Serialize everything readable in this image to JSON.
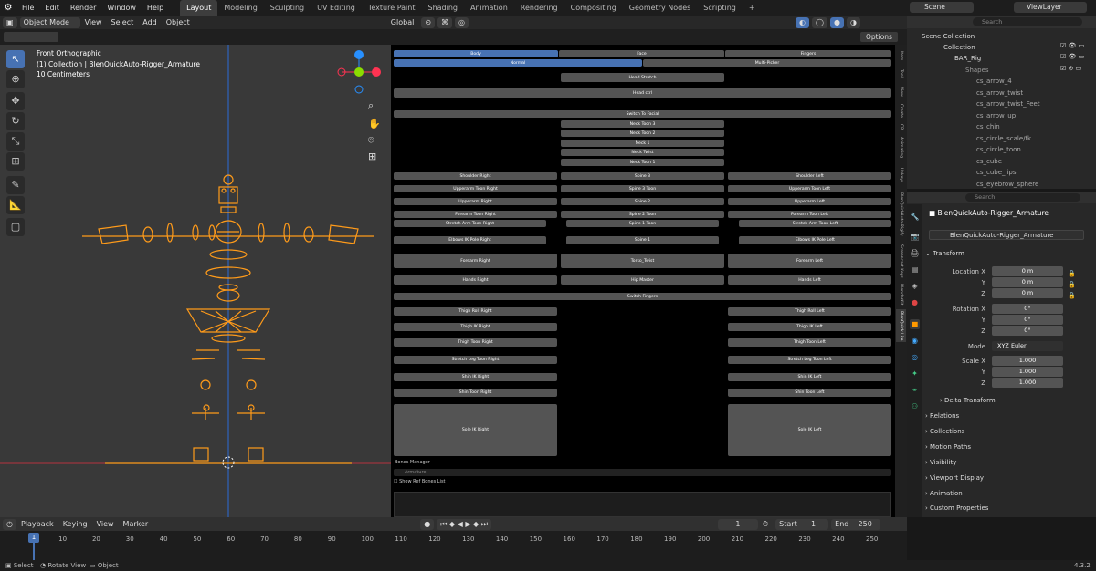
{
  "menu": [
    "File",
    "Edit",
    "Render",
    "Window",
    "Help"
  ],
  "workspaces": [
    "Layout",
    "Modeling",
    "Sculpting",
    "UV Editing",
    "Texture Paint",
    "Shading",
    "Animation",
    "Rendering",
    "Compositing",
    "Geometry Nodes",
    "Scripting"
  ],
  "active_workspace": "Layout",
  "scene": "Scene",
  "view_layer": "ViewLayer",
  "header": {
    "mode": "Object Mode",
    "view": "View",
    "select": "Select",
    "add": "Add",
    "object": "Object",
    "transform": "Global",
    "search_placeholder": "Search",
    "options": "Options"
  },
  "viewport": {
    "title": "Front Orthographic",
    "collection": "(1) Collection | BlenQuickAuto-Rigger_Armature",
    "scale": "10 Centimeters"
  },
  "picker": {
    "tabs_top": [
      "Body",
      "Face",
      "Fingers"
    ],
    "tabs_mode": [
      "Normal",
      "Multi-Picker"
    ],
    "head_stretch": "Head Stretch",
    "head_ctrl": "Head ctrl",
    "switch_facial": "Switch To Facial",
    "neck": [
      "Neck Toon 3",
      "Neck Toon 2",
      "Neck 1",
      "Neck Twist",
      "Neck Toon 1"
    ],
    "shoulder_r": "Shoulder Right",
    "spine3": "Spine 3",
    "shoulder_l": "Shoulder Left",
    "upperarm_toon_r": "Upperarm Toon Right",
    "spine3_toon": "Spine 3 Toon",
    "upperarm_toon_l": "Upperarm Toon Left",
    "upperarm_r": "Upperarm Right",
    "spine2": "Spine 2",
    "upperarm_l": "Upperarm Left",
    "forearm_toon_r": "Forearm Toon Right",
    "spine2_toon": "Spine 2 Toon",
    "forearm_toon_l": "Forearm Toon Left",
    "stretch_arm_r": "Stretch Arm Toon Right",
    "spine1_toon": "Spine 1 Toon",
    "stretch_arm_l": "Stretch Arm Toon Left",
    "elbow_ik_r": "Elbows IK Pole Right",
    "spine1": "Spine 1",
    "elbow_ik_l": "Elbows IK Pole Left",
    "forearm_r": "Forearm Right",
    "torso_twist": "Torso_Twist",
    "forearm_l": "Forearm Left",
    "hands_r": "Hands Right",
    "hip_master": "Hip Master",
    "hands_l": "Hands Left",
    "switch_fingers": "Switch Fingers",
    "thigh_roll_r": "Thigh Roll Right",
    "thigh_roll_l": "Thigh Roll Left",
    "thigh_ik_r": "Thigh IK Right",
    "thigh_ik_l": "Thigh IK Left",
    "thigh_toon_r": "Thigh Toon Right",
    "thigh_toon_l": "Thigh Toon Left",
    "stretch_leg_r": "Stretch Leg Toon Right",
    "stretch_leg_l": "Stretch Leg Toon Left",
    "shin_ik_r": "Shin IK Right",
    "shin_ik_l": "Shin IK Left",
    "shin_toon_r": "Shin Toon Right",
    "shin_toon_l": "Shin Toon Left",
    "sole_ik_r": "Sole IK Right",
    "sole_ik_l": "Sole IK Left",
    "bones_manager": "Bones Manager",
    "bones_placeholder": "Armature",
    "show_ref": "Show Ref Bones List"
  },
  "side_tabs": [
    "Item",
    "Tool",
    "View",
    "Create",
    "CP",
    "Animating",
    "Unkeys",
    "BlenQuickAuto-Rigify",
    "Screencast Keys",
    "BlenderKit",
    "BlenQuick Lite"
  ],
  "outliner": {
    "root": "Scene Collection",
    "items": [
      {
        "name": "Collection",
        "level": 1
      },
      {
        "name": "BAR_Rig",
        "level": 2
      },
      {
        "name": "Shapes",
        "level": 3
      },
      {
        "name": "cs_arrow_4",
        "level": 4
      },
      {
        "name": "cs_arrow_twist",
        "level": 4
      },
      {
        "name": "cs_arrow_twist_Feet",
        "level": 4
      },
      {
        "name": "cs_arrow_up",
        "level": 4
      },
      {
        "name": "cs_chin",
        "level": 4
      },
      {
        "name": "cs_circle_scale/fk",
        "level": 4
      },
      {
        "name": "cs_circle_toon",
        "level": 4
      },
      {
        "name": "cs_cube",
        "level": 4
      },
      {
        "name": "cs_cube_lips",
        "level": 4
      },
      {
        "name": "cs_eyebrow_sphere",
        "level": 4
      }
    ]
  },
  "properties": {
    "search_placeholder": "Search",
    "object_name": "BlenQuickAuto-Rigger_Armature",
    "object_data": "BlenQuickAuto-Rigger_Armature",
    "transform": "Transform",
    "location_label": "Location X",
    "location": [
      "0 m",
      "0 m",
      "0 m"
    ],
    "rotation_label": "Rotation X",
    "rotation": [
      "0°",
      "0°",
      "0°"
    ],
    "mode_label": "Mode",
    "mode": "XYZ Euler",
    "scale_label": "Scale X",
    "scale": [
      "1.000",
      "1.000",
      "1.000"
    ],
    "axis_y": "Y",
    "axis_z": "Z",
    "delta": "Delta Transform",
    "sections": [
      "Relations",
      "Collections",
      "Motion Paths",
      "Visibility",
      "Viewport Display",
      "Animation",
      "Custom Properties"
    ]
  },
  "timeline": {
    "menus": [
      "Playback",
      "Keying",
      "View",
      "Marker"
    ],
    "current": "1",
    "start_label": "Start",
    "start": "1",
    "end_label": "End",
    "end": "250",
    "ticks": [
      "1",
      "10",
      "20",
      "30",
      "40",
      "50",
      "60",
      "70",
      "80",
      "90",
      "100",
      "110",
      "120",
      "130",
      "140",
      "150",
      "160",
      "170",
      "180",
      "190",
      "200",
      "210",
      "220",
      "230",
      "240",
      "250"
    ]
  },
  "status": {
    "select": "Select",
    "rotate": "Rotate View",
    "object": "Object",
    "version": "4.3.2"
  },
  "colors": {
    "accent": "#4772b3",
    "rig": "#ff9b1a",
    "x_axis": "#ff3352",
    "y_axis": "#8bdc00",
    "z_axis": "#2890ff"
  }
}
